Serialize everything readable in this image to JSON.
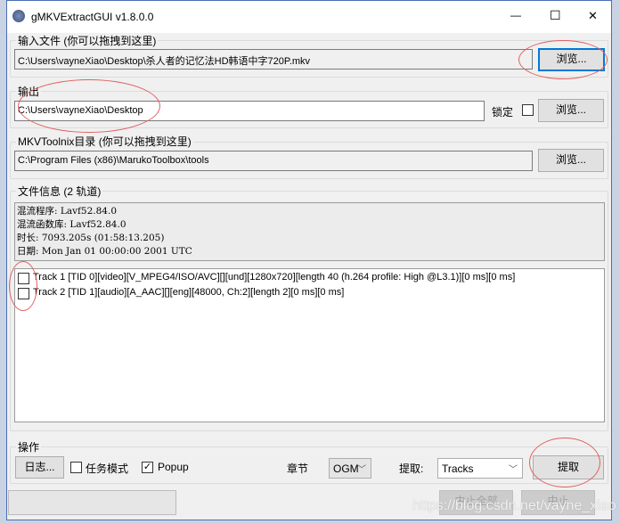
{
  "window": {
    "title": "gMKVExtractGUI v1.8.0.0",
    "minimize": "—",
    "maximize": "☐",
    "close": "✕"
  },
  "input": {
    "label": "输入文件 (你可以拖拽到这里)",
    "value": "C:\\Users\\vayneXiao\\Desktop\\杀人者的记忆法HD韩语中字720P.mkv",
    "browse": "浏览..."
  },
  "output": {
    "label": "输出",
    "value": "C:\\Users\\vayneXiao\\Desktop",
    "lock_label": "锁定",
    "lock_checked": false,
    "browse": "浏览..."
  },
  "toolnix": {
    "label": "MKVToolnix目录 (你可以拖拽到这里)",
    "value": "C:\\Program Files (x86)\\MarukoToolbox\\tools",
    "browse": "浏览..."
  },
  "fileinfo": {
    "label": "文件信息 (2 轨道)",
    "lines": [
      "混流程序: Lavf52.84.0",
      "混流函数库: Lavf52.84.0",
      "时长: 7093.205s (01:58:13.205)",
      "日期: Mon Jan 01 00:00:00 2001 UTC"
    ]
  },
  "tracks": [
    {
      "label": "Track 1 [TID 0][video][V_MPEG4/ISO/AVC][][und][1280x720][length 40 (h.264 profile: High @L3.1)][0 ms][0 ms]",
      "checked": false
    },
    {
      "label": "Track 2 [TID 1][audio][A_AAC][][eng][48000, Ch:2][length 2][0 ms][0 ms]",
      "checked": false
    }
  ],
  "actions": {
    "label": "操作",
    "log": "日志...",
    "job_mode": "任务模式",
    "job_mode_checked": false,
    "popup": "Popup",
    "popup_checked": true,
    "chapters_label": "章节",
    "chapters_value": "OGM",
    "extract_label": "提取:",
    "extract_value": "Tracks",
    "extract_button": "提取"
  },
  "bottom": {
    "abort_all": "中止全部",
    "abort": "中止"
  },
  "watermark": "https://blog.csdn.net/vayne_xiao"
}
